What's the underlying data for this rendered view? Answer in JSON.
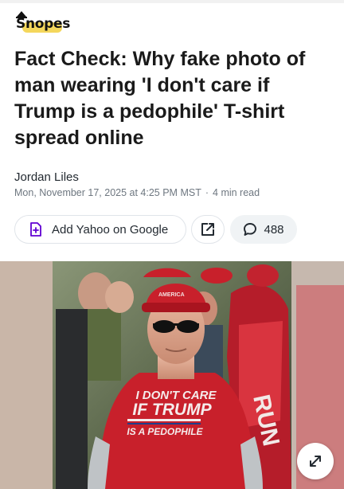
{
  "site": {
    "logo_text": "Snopes"
  },
  "article": {
    "headline": "Fact Check: Why fake photo of man wearing 'I don't care if Trump is a pedophile' T-shirt spread online",
    "author": "Jordan Liles",
    "date": "Mon, November 17, 2025 at 4:25 PM MST",
    "read_time": "4 min read"
  },
  "actions": {
    "google_label": "Add Yahoo on Google",
    "comment_count": "488"
  },
  "image": {
    "shirt_line1": "I DON'T CARE",
    "shirt_line2": "IF TRUMP",
    "shirt_line3": "IS A PEDOPHILE",
    "hat_text": "AMERICA"
  },
  "colors": {
    "accent_yellow": "#f3d34a",
    "google_purple": "#6001d2",
    "shirt_red": "#c8202b"
  },
  "icons": [
    "google-plus-icon",
    "share-icon",
    "comment-icon",
    "expand-icon"
  ]
}
